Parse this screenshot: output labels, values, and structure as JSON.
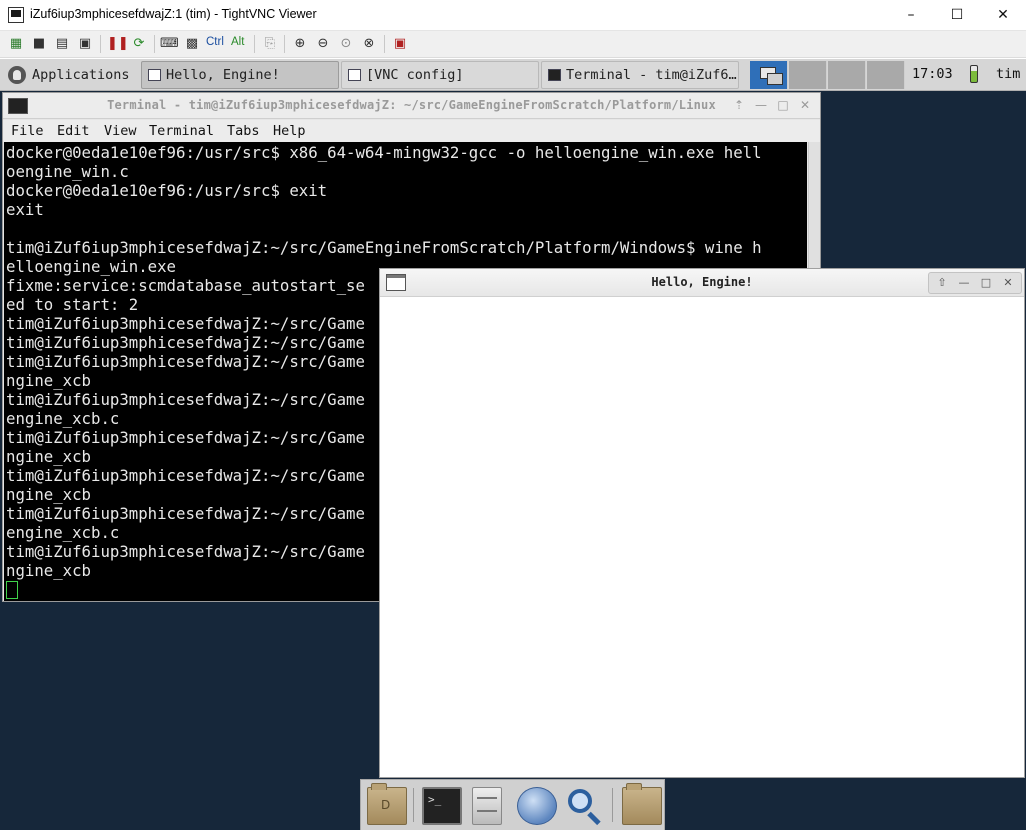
{
  "window": {
    "title": "iZuf6iup3mphicesefdwajZ:1 (tim) - TightVNC Viewer",
    "minimize": "–",
    "maximize": "☐",
    "close": "✕"
  },
  "vnc_toolbar": {
    "ctrl_label": "Ctrl",
    "alt_label": "Alt",
    "icons": [
      "new-connection-icon",
      "save-icon",
      "options-icon",
      "info-icon",
      "pause-icon",
      "refresh-icon",
      "send-ctrl-alt-del-icon",
      "send-ctrl-esc-icon",
      "ctrl-key-icon",
      "alt-key-icon",
      "clipboard-icon",
      "zoom-in-icon",
      "zoom-out-icon",
      "zoom-100-icon",
      "zoom-fit-icon",
      "fullscreen-icon"
    ]
  },
  "panel": {
    "applications": "Applications",
    "tasks": [
      {
        "label": "Hello, Engine!",
        "icon": "window-icon",
        "active": true
      },
      {
        "label": "[VNC config]",
        "icon": "window-icon",
        "active": false
      },
      {
        "label": "Terminal - tim@iZuf6…",
        "icon": "terminal-icon",
        "active": false
      }
    ],
    "clock": "17:03",
    "user": "tim"
  },
  "terminal": {
    "title": "Terminal - tim@iZuf6iup3mphicesefdwajZ: ~/src/GameEngineFromScratch/Platform/Linux",
    "menu": [
      "File",
      "Edit",
      "View",
      "Terminal",
      "Tabs",
      "Help"
    ],
    "lines": [
      "docker@0eda1e10ef96:/usr/src$ x86_64-w64-mingw32-gcc -o helloengine_win.exe hell",
      "oengine_win.c",
      "docker@0eda1e10ef96:/usr/src$ exit",
      "exit",
      "",
      "tim@iZuf6iup3mphicesefdwajZ:~/src/GameEngineFromScratch/Platform/Windows$ wine h",
      "elloengine_win.exe",
      "fixme:service:scmdatabase_autostart_se",
      "ed to start: 2",
      "tim@iZuf6iup3mphicesefdwajZ:~/src/Game",
      "tim@iZuf6iup3mphicesefdwajZ:~/src/Game",
      "tim@iZuf6iup3mphicesefdwajZ:~/src/Game",
      "ngine_xcb",
      "tim@iZuf6iup3mphicesefdwajZ:~/src/Game",
      "engine_xcb.c",
      "tim@iZuf6iup3mphicesefdwajZ:~/src/Game",
      "ngine_xcb",
      "tim@iZuf6iup3mphicesefdwajZ:~/src/Game",
      "ngine_xcb",
      "tim@iZuf6iup3mphicesefdwajZ:~/src/Game",
      "engine_xcb.c",
      "tim@iZuf6iup3mphicesefdwajZ:~/src/Game",
      "ngine_xcb"
    ]
  },
  "hello_window": {
    "title": "Hello, Engine!"
  },
  "dock": {
    "items": [
      "home-folder-icon",
      "terminal-icon",
      "file-manager-icon",
      "web-browser-icon",
      "search-icon",
      "folder-icon"
    ]
  },
  "colors": {
    "desktop_bg": "#16273a",
    "terminal_bg": "#000000",
    "terminal_fg": "#e8e8e8",
    "cursor": "#3fd14a",
    "workspace_active": "#2f6fb8"
  }
}
